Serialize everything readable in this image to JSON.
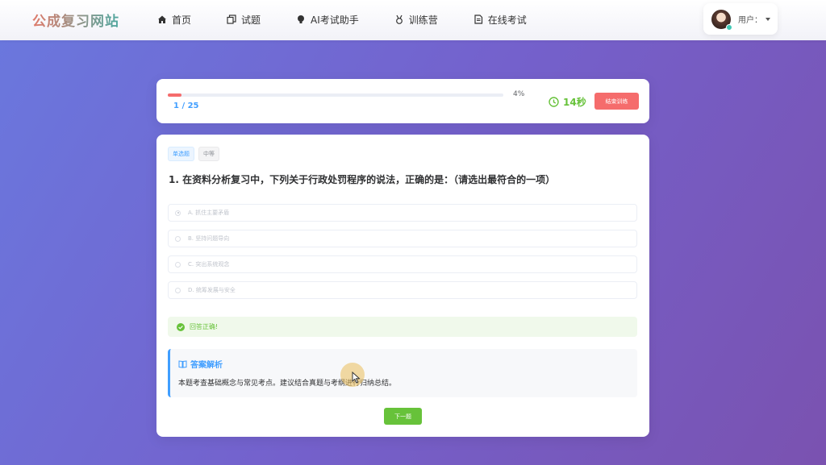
{
  "header": {
    "logo": "公成复习网站",
    "nav": [
      {
        "label": "首页",
        "icon": "home-icon"
      },
      {
        "label": "试题",
        "icon": "copy-icon"
      },
      {
        "label": "AI考试助手",
        "icon": "bulb-icon"
      },
      {
        "label": "训练营",
        "icon": "medal-icon"
      },
      {
        "label": "在线考试",
        "icon": "document-icon"
      }
    ],
    "user_label": "用户："
  },
  "progress": {
    "percent_text": "4%",
    "fraction": 0.04,
    "counter": "1 / 25",
    "timer": "14秒",
    "end_button": "结束训练"
  },
  "question": {
    "tag_type": "单选题",
    "tag_level": "中等",
    "title": "1. 在资料分析复习中，下列关于行政处罚程序的说法，正确的是：（请选出最符合的一项）",
    "options": [
      "A. 抓住主要矛盾",
      "B. 坚持问题导向",
      "C. 突出系统观念",
      "D. 统筹发展与安全"
    ],
    "selected_index": 0,
    "result": "回答正确!",
    "analysis_title": "答案解析",
    "analysis_text": "本题考查基础概念与常见考点。建议结合真题与考纲进行归纳总结。",
    "next_button": "下一题"
  },
  "colors": {
    "primary": "#409eff",
    "success": "#67c23a",
    "danger": "#f56c6c"
  }
}
